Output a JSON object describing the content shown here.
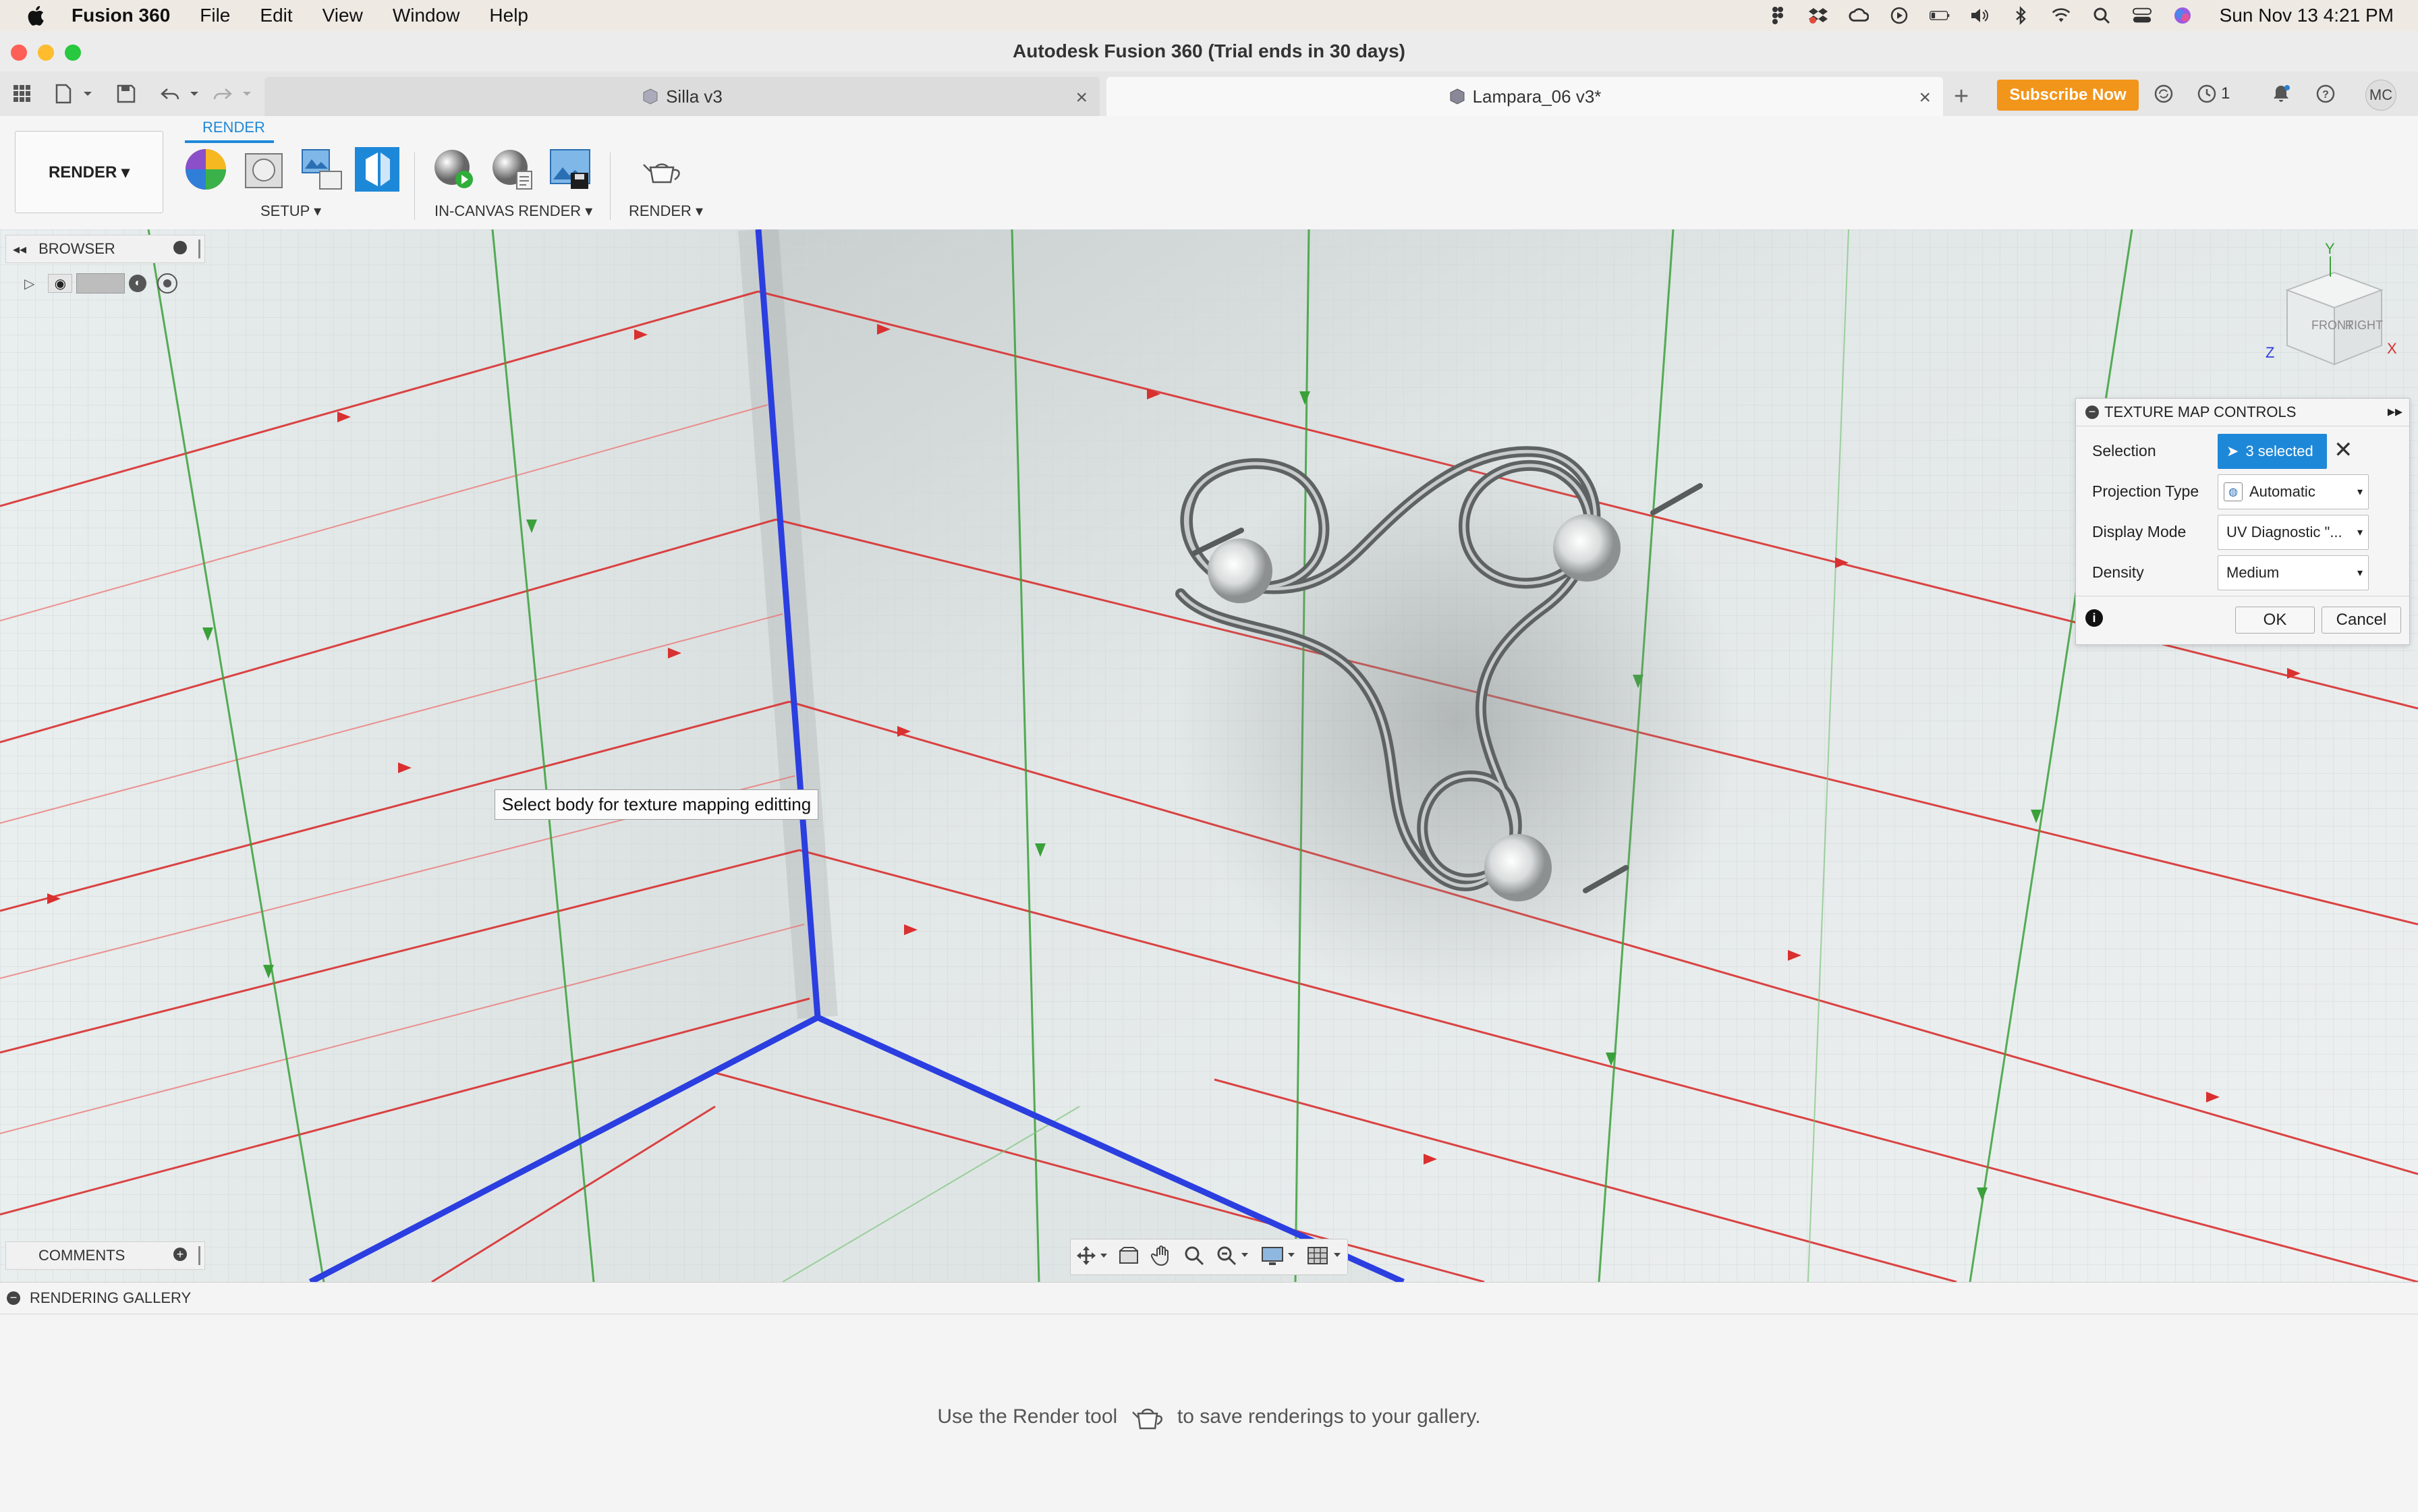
{
  "menubar": {
    "app_name": "Fusion 360",
    "items": [
      "File",
      "Edit",
      "View",
      "Window",
      "Help"
    ],
    "datetime": "Sun Nov 13  4:21 PM",
    "status_icons": [
      "figma-icon",
      "dropbox-icon",
      "creative-cloud-icon",
      "play-icon",
      "battery-icon",
      "volume-icon",
      "bluetooth-icon",
      "wifi-icon",
      "search-icon",
      "control-center-icon",
      "siri-icon"
    ]
  },
  "window": {
    "title": "Autodesk Fusion 360 (Trial ends in 30 days)"
  },
  "tabs": [
    {
      "label": "Silla v3",
      "active": false
    },
    {
      "label": "Lampara_06 v3*",
      "active": true
    }
  ],
  "tabbar": {
    "subscribe_label": "Subscribe Now",
    "jobs_count": "1",
    "user_initials": "MC"
  },
  "toolbar": {
    "tab_label": "RENDER",
    "workspace_label": "RENDER ▾",
    "groups": [
      {
        "label": "SETUP ▾"
      },
      {
        "label": "IN-CANVAS RENDER ▾"
      },
      {
        "label": "RENDER ▾"
      }
    ]
  },
  "browser": {
    "header": "BROWSER"
  },
  "comments": {
    "header": "COMMENTS"
  },
  "tooltip": {
    "text": "Select body for texture mapping editting"
  },
  "viewcube": {
    "front": "FRONT",
    "right": "RIGHT",
    "axis_y": "Y",
    "axis_z": "Z",
    "axis_x": "X"
  },
  "dialog": {
    "title": "TEXTURE MAP CONTROLS",
    "selection_label": "Selection",
    "selection_value": "3 selected",
    "projection_label": "Projection Type",
    "projection_value": "Automatic",
    "display_label": "Display Mode",
    "display_value": "UV Diagnostic \"...",
    "density_label": "Density",
    "density_value": "Medium",
    "ok_label": "OK",
    "cancel_label": "Cancel"
  },
  "gallery": {
    "header": "RENDERING GALLERY",
    "hint_before": "Use the Render tool",
    "hint_after": "to save renderings to your gallery."
  },
  "colors": {
    "accent": "#1e88d8",
    "subscribe": "#f2951b",
    "grid_red": "#d93030",
    "grid_green": "#3aa03a",
    "edge_blue": "#2b3ee0"
  }
}
